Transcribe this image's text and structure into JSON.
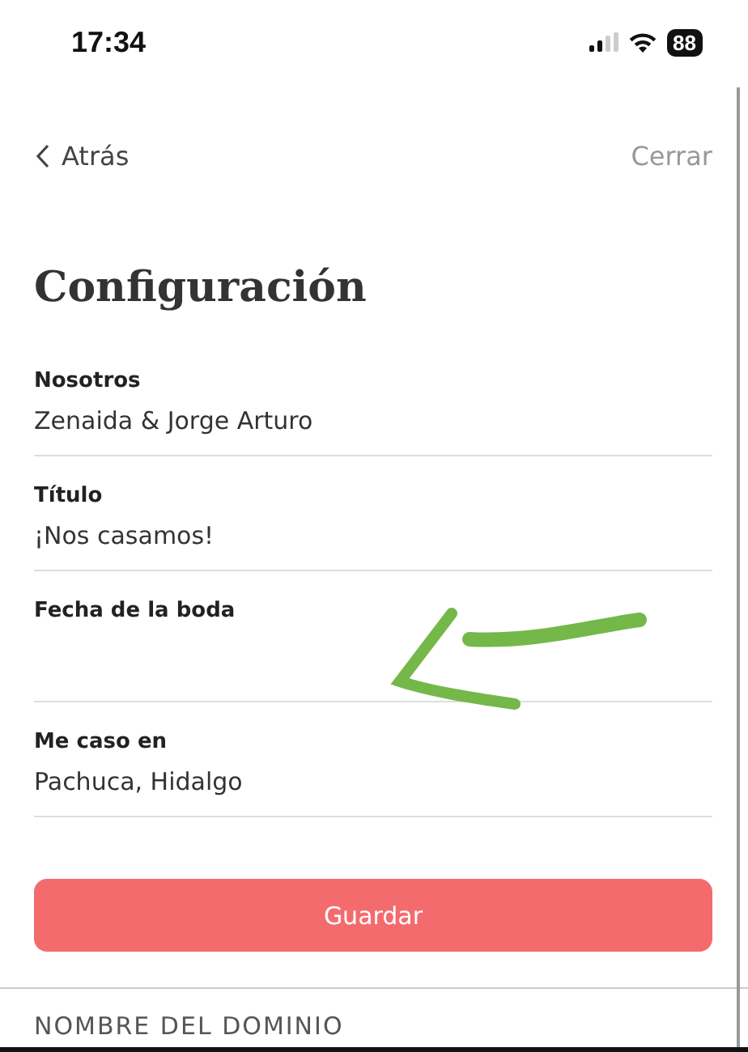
{
  "status_bar": {
    "time": "17:34",
    "battery": "88"
  },
  "nav": {
    "back": "Atrás",
    "close": "Cerrar"
  },
  "title": "Configuración",
  "fields": [
    {
      "label": "Nosotros",
      "value": "Zenaida & Jorge Arturo"
    },
    {
      "label": "Título",
      "value": "¡Nos casamos!"
    },
    {
      "label": "Fecha de la boda"
    },
    {
      "label": "Me caso en",
      "value": "Pachuca, Hidalgo"
    }
  ],
  "save_button": "Guardar",
  "section_heading": "NOMBRE DEL DOMINIO"
}
